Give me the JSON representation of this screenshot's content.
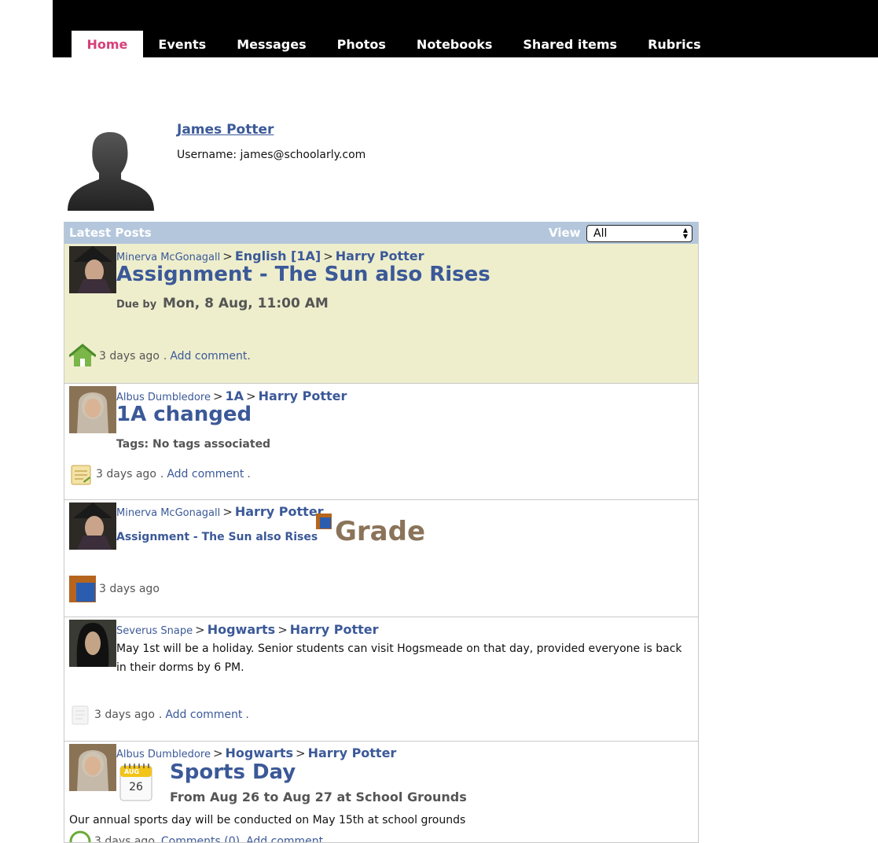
{
  "nav": {
    "tabs": [
      {
        "label": "Home",
        "active": true
      },
      {
        "label": "Events"
      },
      {
        "label": "Messages"
      },
      {
        "label": "Photos"
      },
      {
        "label": "Notebooks"
      },
      {
        "label": "Shared items"
      },
      {
        "label": "Rubrics"
      }
    ]
  },
  "profile": {
    "name": "James Potter",
    "username_line": "Username: james@schoolarly.com"
  },
  "posts_panel": {
    "title": "Latest Posts",
    "view_label": "View",
    "view_selected": "All"
  },
  "posts": [
    {
      "author": "Minerva McGonagall",
      "path1": "English [1A]",
      "path2": "Harry Potter",
      "title": "Assignment - The Sun also Rises",
      "due_label": "Due by",
      "due_value": "Mon, 8 Aug, 11:00 AM",
      "time": "3 days ago",
      "dot1": ".",
      "comment_link": "Add comment",
      "dot2": ".",
      "icon": "home-icon"
    },
    {
      "author": "Albus Dumbledore",
      "path1": "1A",
      "path2": "Harry Potter",
      "title": "1A changed",
      "tags_line": "Tags: No tags associated",
      "time": "3 days ago",
      "dot1": ".",
      "comment_link": "Add comment",
      "dot2": ".",
      "icon": "notebook-icon"
    },
    {
      "author": "Minerva McGonagall",
      "path1": "Harry Potter",
      "link": "Assignment - The Sun also Rises",
      "grade_label": "Grade",
      "time": "3 days ago",
      "icon": "grade-book-icon"
    },
    {
      "author": "Severus Snape",
      "path1": "Hogwarts",
      "path2": "Harry Potter",
      "body": "May 1st will be a holiday. Senior students can visit Hogsmeade on that day, provided everyone is back in their dorms by 6 PM.",
      "time": "3 days ago",
      "dot1": ".",
      "comment_link": "Add comment",
      "dot2": ".",
      "icon": "message-icon"
    },
    {
      "author": "Albus Dumbledore",
      "path1": "Hogwarts",
      "path2": "Harry Potter",
      "title": "Sports Day",
      "calendar_month": "AUG",
      "calendar_day": "26",
      "when": "From Aug 26 to Aug 27 at School Grounds",
      "body": "Our annual sports day will be conducted on May 15th at school grounds",
      "time": "3 days ago",
      "comments_link": "Comments (0)",
      "comment_link": "Add comment",
      "icon": "clock-icon"
    }
  ],
  "colors": {
    "nav_bg": "#000000",
    "active_tab_text": "#d6407a",
    "link": "#3b5998",
    "panel_header": "#b3c6dc",
    "highlight_row": "#eeeecd",
    "grade_text": "#8b735a"
  }
}
